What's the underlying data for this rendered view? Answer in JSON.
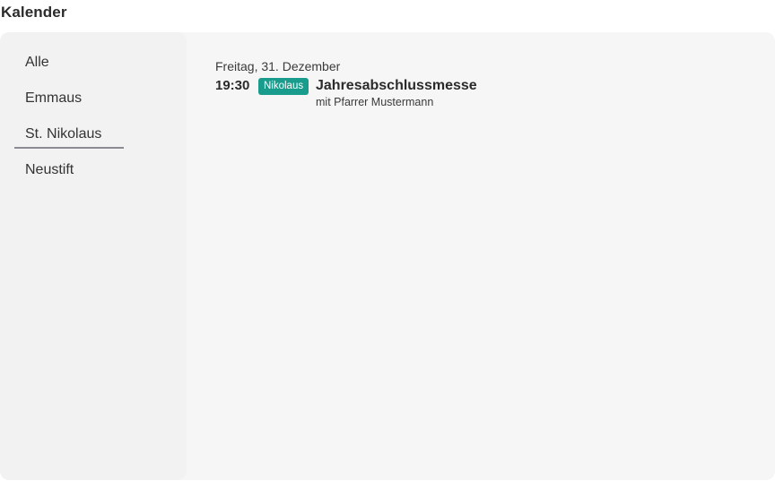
{
  "page": {
    "title": "Kalender"
  },
  "sidebar": {
    "items": [
      {
        "label": "Alle",
        "active": false
      },
      {
        "label": "Emmaus",
        "active": false
      },
      {
        "label": "St. Nikolaus",
        "active": true
      },
      {
        "label": "Neustift",
        "active": false
      }
    ]
  },
  "events": {
    "day": {
      "date_label": "Freitag, 31. Dezember",
      "items": [
        {
          "time": "19:30",
          "badge": "Nikolaus",
          "title": "Jahresabschlussmesse",
          "subtitle": "mit Pfarrer Mustermann"
        }
      ]
    }
  },
  "colors": {
    "badge_background": "#1a9c8c",
    "panel_background": "#f6f6f6",
    "sidebar_background": "#f2f2f2",
    "active_underline": "#8a8a90"
  }
}
